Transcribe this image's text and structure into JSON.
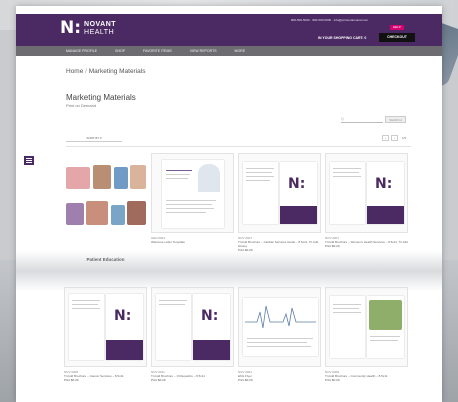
{
  "header": {
    "logo_mark": "N:",
    "logo_line1": "NOVANT",
    "logo_line2": "HEALTH",
    "utility_text": "800-500-5000 · 800-500-5000 · info@printondemand.com",
    "help_label": "HELP",
    "cart_text": "IN YOUR SHOPPING CART: 0",
    "checkout_label": "CHECKOUT"
  },
  "nav": [
    "MANAGE PROFILE",
    "SHOP",
    "FAVORITE ITEMS",
    "VIEW REPORTS",
    "MORE"
  ],
  "breadcrumb": {
    "home": "Home",
    "separator": " / ",
    "current": "Marketing Materials"
  },
  "page": {
    "title": "Marketing Materials",
    "subtitle": "Print on Demand"
  },
  "search": {
    "placeholder": "Q",
    "button_label": "SEARCH"
  },
  "sort": {
    "label": "SORT BY ▾"
  },
  "pager": {
    "prev": "‹",
    "next": "›",
    "count": "1/5"
  },
  "products": [
    {
      "title": "Patient Education",
      "id": "",
      "desc": "",
      "price": ""
    },
    {
      "title": "",
      "id": "GEN 0001",
      "desc": "Welcome Letter Template",
      "price": ""
    },
    {
      "title": "",
      "id": "NOV 0007",
      "desc": "Tri-fold Brochure – Cardiac Services Guide – 8.5x11, Tri-fold, Glossy",
      "price": "Print $0.29"
    },
    {
      "title": "",
      "id": "NOV 0007",
      "desc": "Tri-fold Brochure – Women's Health Services – 8.5x11, Tri-fold",
      "price": "Print $0.29"
    },
    {
      "title": "",
      "id": "NOV 0008",
      "desc": "Tri-fold Brochure – Cancer Services – 8.5x11",
      "price": "Print $0.29"
    },
    {
      "title": "",
      "id": "NOV 0011",
      "desc": "Tri-fold Brochure – Orthopedics – 8.5x11",
      "price": "Print $0.29"
    },
    {
      "title": "",
      "id": "NOV 0001",
      "desc": "EKG Flyer",
      "price": "Print $0.29"
    },
    {
      "title": "",
      "id": "NOV 0009",
      "desc": "Tri-fold Brochure – Community Health – 8.5x11",
      "price": "Print $0.29"
    }
  ],
  "colors": {
    "brand": "#4b2a63",
    "nav": "#6d6d71",
    "accent": "#d6006e"
  }
}
